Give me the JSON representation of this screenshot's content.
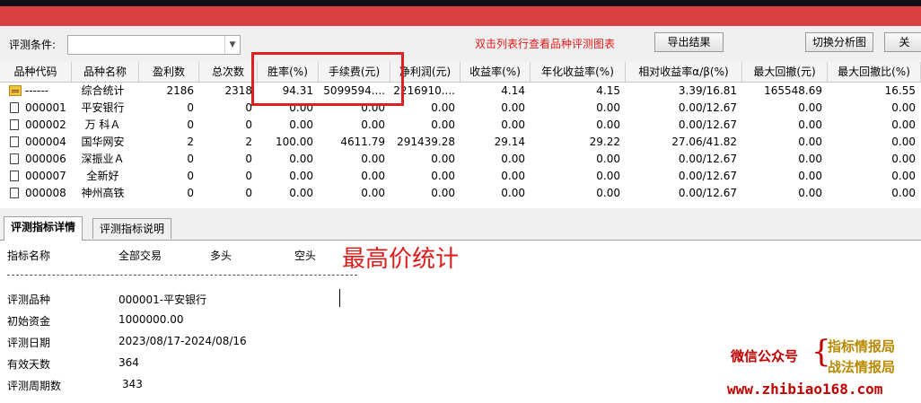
{
  "colors": {
    "titlebar": "#d84041",
    "hint": "#e01a1a",
    "highlight": "#e02020",
    "watermark_red": "#c00000",
    "watermark_gold": "#b88a00"
  },
  "condition": {
    "label": "评测条件:",
    "value": "",
    "hint": "双击列表行查看品种评测图表",
    "export_btn": "导出结果",
    "switch_btn": "切换分析图",
    "close_btn": "关"
  },
  "table": {
    "headers": [
      "品种代码",
      "品种名称",
      "盈利数",
      "总次数",
      "胜率(%)",
      "手续费(元)",
      "净利润(元)",
      "收益率(%)",
      "年化收益率(%)",
      "相对收益率α/β(%)",
      "最大回撤(元)",
      "最大回撤比(%)"
    ],
    "rows": [
      {
        "icon": "folder-icon",
        "code": "------",
        "name": "综合统计",
        "win": "2186",
        "total": "2318",
        "rate": "94.31",
        "fee": "5099594....",
        "profit": "2216910....",
        "ret": "4.14",
        "annual": "4.15",
        "rel": "3.39/16.81",
        "maxdd": "165548.69",
        "maxddr": "16.55"
      },
      {
        "icon": "document-icon",
        "code": "000001",
        "name": "平安银行",
        "win": "0",
        "total": "0",
        "rate": "0.00",
        "fee": "0.00",
        "profit": "0.00",
        "ret": "0.00",
        "annual": "0.00",
        "rel": "0.00/12.67",
        "maxdd": "0.00",
        "maxddr": "0.00"
      },
      {
        "icon": "document-icon",
        "code": "000002",
        "name": "万 科Ａ",
        "win": "0",
        "total": "0",
        "rate": "0.00",
        "fee": "0.00",
        "profit": "0.00",
        "ret": "0.00",
        "annual": "0.00",
        "rel": "0.00/12.67",
        "maxdd": "0.00",
        "maxddr": "0.00"
      },
      {
        "icon": "document-icon",
        "code": "000004",
        "name": "国华网安",
        "win": "2",
        "total": "2",
        "rate": "100.00",
        "fee": "4611.79",
        "profit": "291439.28",
        "ret": "29.14",
        "annual": "29.22",
        "rel": "27.06/41.82",
        "maxdd": "0.00",
        "maxddr": "0.00"
      },
      {
        "icon": "document-icon",
        "code": "000006",
        "name": "深振业Ａ",
        "win": "0",
        "total": "0",
        "rate": "0.00",
        "fee": "0.00",
        "profit": "0.00",
        "ret": "0.00",
        "annual": "0.00",
        "rel": "0.00/12.67",
        "maxdd": "0.00",
        "maxddr": "0.00"
      },
      {
        "icon": "document-icon",
        "code": "000007",
        "name": "全新好",
        "win": "0",
        "total": "0",
        "rate": "0.00",
        "fee": "0.00",
        "profit": "0.00",
        "ret": "0.00",
        "annual": "0.00",
        "rel": "0.00/12.67",
        "maxdd": "0.00",
        "maxddr": "0.00"
      },
      {
        "icon": "document-icon",
        "code": "000008",
        "name": "神州高铁",
        "win": "0",
        "total": "0",
        "rate": "0.00",
        "fee": "0.00",
        "profit": "0.00",
        "ret": "0.00",
        "annual": "0.00",
        "rel": "0.00/12.67",
        "maxdd": "0.00",
        "maxddr": "0.00"
      }
    ]
  },
  "tabs": {
    "detail": "评测指标详情",
    "explain": "评测指标说明"
  },
  "detail": {
    "col_name": "指标名称",
    "col_all": "全部交易",
    "col_long": "多头",
    "col_short": "空头",
    "annotation": "最高价统计",
    "items": [
      {
        "label": "评测品种",
        "value": "000001-平安银行"
      },
      {
        "label": "初始资金",
        "value": "1000000.00"
      },
      {
        "label": "评测日期",
        "value": "2023/08/17-2024/08/16"
      },
      {
        "label": "有效天数",
        "value": "364"
      },
      {
        "label": "评测周期数",
        "value": "343"
      }
    ]
  },
  "watermark": {
    "wechat": "微信公众号",
    "line1": "指标情报局",
    "line2": "战法情报局",
    "url": "www.zhibiao168.com"
  }
}
